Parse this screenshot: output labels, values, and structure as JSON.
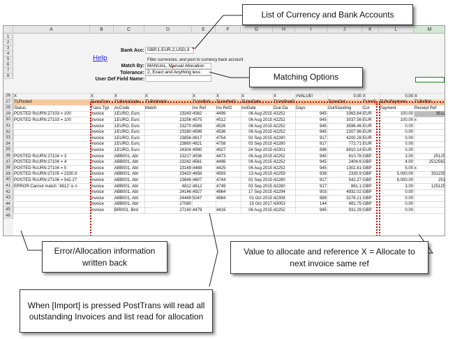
{
  "columns": [
    "A",
    "B",
    "C",
    "D",
    "E",
    "F",
    "G",
    "H",
    "I",
    "J",
    "K",
    "L",
    "M"
  ],
  "row_numbers": [
    "1",
    "2",
    "3",
    "4",
    "5",
    "6",
    "7",
    "8",
    "26",
    "27",
    "28",
    "29",
    "30",
    "31",
    "32",
    "33",
    "34",
    "35",
    "36",
    "37",
    "38",
    "39",
    "40",
    "41",
    "42",
    "43",
    "44",
    "45",
    "46"
  ],
  "settings": {
    "bank_acc_label": "Bank Acc:",
    "bank_acc_value": "GBP,1,EUR,2,USD,3",
    "help_link": "Help",
    "filter_note": "Filter currencies, and post to currency back account",
    "match_by_label": "Match By:",
    "match_by_value": "MANUAL, Manual Allocation",
    "tolerance_label": "Tolerance:",
    "tolerance_value": "2, Exact and Anything less",
    "udf_label": "User Def Field Name:",
    "udf_value": ""
  },
  "row27": {
    "a": "X",
    "b": "X",
    "c": "X",
    "d": "X",
    "e": "X",
    "f": "X",
    "g": "X",
    "h": "X",
    "i": "#VALUE!",
    "j": "0.00",
    "k": "X",
    "l": "0.00",
    "m": "X"
  },
  "row28": {
    "a": "TLPosted",
    "b": "TLInvTran",
    "c": "TLRcAcCode",
    "d": "TLRcMatch",
    "e": "TLInvRef",
    "f": "TLInvRef2",
    "g": "TLInvDate",
    "h": "TLInvDueD",
    "j": "TLInvOut",
    "k": "TLInvC",
    "l": "TLRcPayment",
    "m": "TLRcRef"
  },
  "row29": {
    "a": "Status",
    "b": "Trans Typ",
    "c": "AcCode",
    "d": "Match",
    "e": "Inv Ref",
    "f": "Inv Ref2",
    "g": "InvDate",
    "h": "Due Da",
    "i": "Days",
    "j": "OutStanding",
    "k": "Cur",
    "l": "Payment",
    "m": "Receipt Ref"
  },
  "rows": [
    {
      "status": "POSTED RcURN:27103 = 100",
      "type": "Invoice",
      "ac": "1EURO, Eurc",
      "match": "23243",
      "ref": "4562",
      "ref2": "4499",
      "date": "06 Aug 2015",
      "due": "42252",
      "days": "945",
      "out": "3363.84",
      "cur": "EUR",
      "pay": "100.00",
      "rref": "3512"
    },
    {
      "status": "POSTED RcURN:27103 = 100",
      "type": "Invoice",
      "ac": "1EURO, Eurc",
      "match": "23256",
      "ref": "4575",
      "ref2": "4512",
      "date": "06 Aug 2015",
      "due": "42252",
      "days": "945",
      "out": "3037.56",
      "cur": "EUR",
      "pay": "100.00",
      "rref": "x"
    },
    {
      "status": "",
      "type": "Invoice",
      "ac": "1EURO, Eurc",
      "match": "23270",
      "ref": "4589",
      "ref2": "4526",
      "date": "06 Aug 2015",
      "due": "42252",
      "days": "945",
      "out": "3596.46",
      "cur": "EUR",
      "pay": "0.00",
      "rref": ""
    },
    {
      "status": "",
      "type": "Invoice",
      "ac": "1EURO, Eurc",
      "match": "23280",
      "ref": "4599",
      "ref2": "4536",
      "date": "06 Aug 2015",
      "due": "42252",
      "days": "945",
      "out": "2207.96",
      "cur": "EUR",
      "pay": "0.00",
      "rref": ""
    },
    {
      "status": "",
      "type": "Invoice",
      "ac": "1EURO, Eurc",
      "match": "23856",
      "ref": "4817",
      "ref2": "4754",
      "date": "03 Sep 2015",
      "due": "42280",
      "days": "917",
      "out": "4200.28",
      "cur": "EUR",
      "pay": "0.00",
      "rref": ""
    },
    {
      "status": "",
      "type": "Invoice",
      "ac": "1EURO, Eurc",
      "match": "23860",
      "ref": "4821",
      "ref2": "4758",
      "date": "03 Sep 2015",
      "due": "42280",
      "days": "917",
      "out": "772.71",
      "cur": "EUR",
      "pay": "0.00",
      "rref": ""
    },
    {
      "status": "",
      "type": "Invoice",
      "ac": "1EURO, Eurc",
      "match": "24304",
      "ref": "4990",
      "ref2": "4927",
      "date": "24 Sep 2015",
      "due": "42301",
      "days": "896",
      "out": "8910.14",
      "cur": "EUR",
      "pay": "0.00",
      "rref": ""
    },
    {
      "status": "POSTED RcURN:27104 = 3",
      "type": "Invoice",
      "ac": "ABB001, Abt",
      "match": "23217",
      "ref": "4536",
      "ref2": "4473",
      "date": "06 Aug 2015",
      "due": "42252",
      "days": "945",
      "out": "610.78",
      "cur": "GBP",
      "pay": "3.00",
      "rref": "25125"
    },
    {
      "status": "POSTED RcURN:27104 = 4",
      "type": "Invoice",
      "ac": "ABB001, Abt",
      "match": "23242",
      "ref": "4561",
      "ref2": "4498",
      "date": "06 Aug 2015",
      "due": "42252",
      "days": "945",
      "out": "2404.6",
      "cur": "GBP",
      "pay": "4.00",
      "rref": "2512563"
    },
    {
      "status": "POSTED RcURN:27104 = 5",
      "type": "Invoice",
      "ac": "ABB001, Abt",
      "match": "23169",
      "ref": "4488",
      "ref2": "4425",
      "date": "06 Aug 2015",
      "due": "42252",
      "days": "945",
      "out": "1302.81",
      "cur": "GBP",
      "pay": "5.00",
      "rref": "x"
    },
    {
      "status": "POSTED RcURN:27105 = 2330.9",
      "type": "Invoice",
      "ac": "ABB001, Abt",
      "match": "23420",
      "ref": "4656",
      "ref2": "4593",
      "date": "13 Aug 2015",
      "due": "42259",
      "days": "938",
      "out": "2330.9",
      "cur": "GBP",
      "pay": "5,000.00",
      "rref": "331235"
    },
    {
      "status": "POSTED RcURN:27106 = 542.27",
      "type": "Invoice",
      "ac": "ABB001, Abt",
      "match": "23846",
      "ref": "4807",
      "ref2": "4744",
      "date": "03 Sep 2015",
      "due": "42280",
      "days": "917",
      "out": "542.27",
      "cur": "GBP",
      "pay": "6,000.00",
      "rref": "251"
    },
    {
      "status": "ERROR:Cannot match: '4812' is n",
      "type": "Invoice",
      "ac": "ABB001, Abt",
      "match": "4812",
      "ref": "4812",
      "ref2": "4749",
      "date": "03 Sep 2015",
      "due": "42280",
      "days": "917",
      "out": "861.1",
      "cur": "GBP",
      "pay": "3.00",
      "rref": "125125"
    },
    {
      "status": "",
      "type": "Invoice",
      "ac": "ABB001, Abt",
      "match": "24146",
      "ref": "4927",
      "ref2": "4864",
      "date": "17 Sep 2015",
      "due": "42294",
      "days": "903",
      "out": "4932.02",
      "cur": "GBP",
      "pay": "0.00",
      "rref": ""
    },
    {
      "status": "",
      "type": "Invoice",
      "ac": "ABB001, Abt",
      "match": "24449",
      "ref": "5047",
      "ref2": "4984",
      "date": "01 Oct 2015",
      "due": "42308",
      "days": "889",
      "out": "3276.21",
      "cur": "GBP",
      "pay": "0.00",
      "rref": ""
    },
    {
      "status": "",
      "type": "Invoice",
      "ac": "ABB001, Abt",
      "match": "27080",
      "ref": "",
      "ref2": "",
      "date": "15 Oct 2017",
      "due": "43053",
      "days": "144",
      "out": "481.75",
      "cur": "GBP",
      "pay": "0.00",
      "rref": ""
    },
    {
      "status": "",
      "type": "Invoice",
      "ac": "BIR001, Bird",
      "match": "27160",
      "ref": "4479",
      "ref2": "4416",
      "date": "06 Aug 2015",
      "due": "42252",
      "days": "945",
      "out": "931.29",
      "cur": "GBP",
      "pay": "0.00",
      "rref": ""
    }
  ],
  "callouts": {
    "currency": "List of Currency and Bank Accounts",
    "matching": "Matching Options",
    "error": "Error/Allocation information written back",
    "import": "When [Import] is pressed PostTrans will read all outstanding Invoices and list read for allocation",
    "allocate": "Value to allocate and reference X = Allocate to next invoice same ref"
  }
}
